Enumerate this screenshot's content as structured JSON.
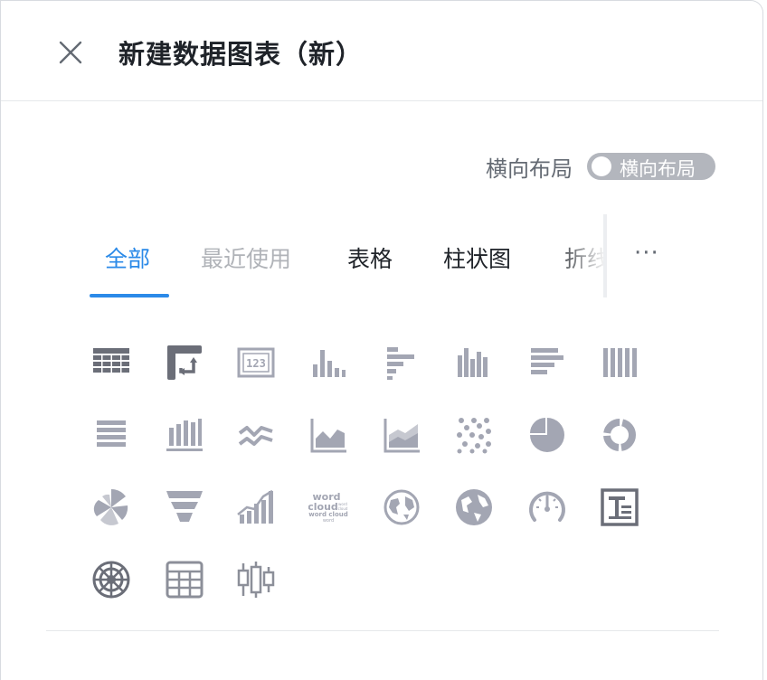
{
  "dialog": {
    "title": "新建数据图表（新）"
  },
  "layout_toggle": {
    "label": "横向布局",
    "switch_text": "横向布局"
  },
  "tabs": [
    {
      "label": "全部"
    },
    {
      "label": "最近使用"
    },
    {
      "label": "表格"
    },
    {
      "label": "柱状图"
    },
    {
      "label": "折线"
    }
  ],
  "more": "···",
  "chart_types": {
    "word_cloud": {
      "line1": "word",
      "line2": "cloud",
      "line3": "word cloud",
      "small1": "word",
      "small2": "cloud"
    }
  },
  "colors": {
    "accent": "#2b8ae8",
    "icon": "#a3a6b3",
    "icon_dark": "#6b6e78"
  }
}
